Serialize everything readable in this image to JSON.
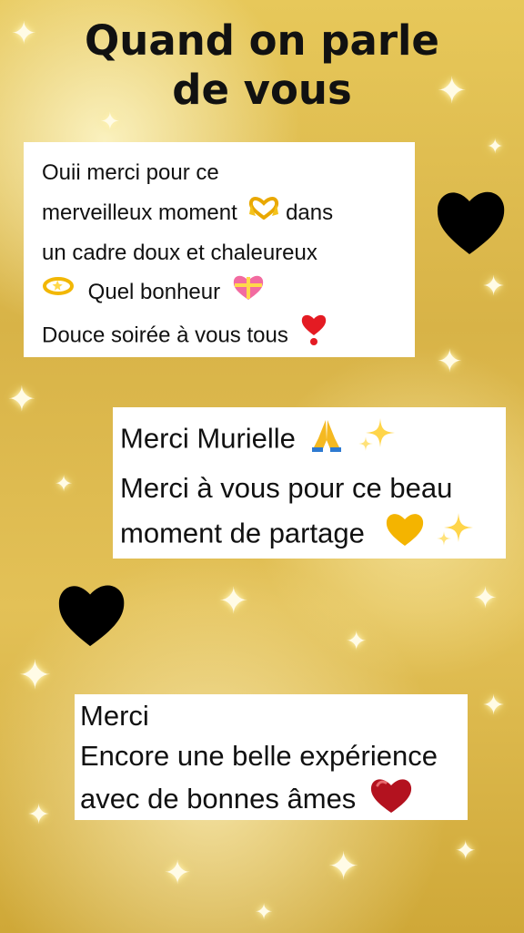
{
  "title": {
    "line1": "Quand on parle",
    "line2": "de vous"
  },
  "messages": [
    {
      "lines": [
        "Ouii merci pour ce",
        "merveilleux moment",
        "dans",
        "un cadre doux et chaleureux",
        "Quel bonheur",
        "Douce soirée à vous tous"
      ]
    },
    {
      "lines": [
        "Merci Murielle",
        "Merci à vous pour ce beau",
        "moment de partage"
      ]
    },
    {
      "lines": [
        "Merci",
        "Encore une belle expérience",
        "avec de bonnes âmes"
      ]
    }
  ],
  "icons": {
    "heart_hands": "heart-hands-icon",
    "halo": "halo-icon",
    "gift_heart": "gift-heart-icon",
    "exclamation_heart": "heavy-heart-exclamation-icon",
    "pray": "folded-hands-icon",
    "sparkles": "sparkles-icon",
    "yellow_heart": "yellow-heart-icon",
    "red_heart": "red-heart-icon",
    "black_heart": "black-heart-icon"
  },
  "colors": {
    "background_gold": "#dcb94c",
    "bubble": "#ffffff",
    "text": "#111111",
    "black_heart": "#000000",
    "red_heart": "#b3121f",
    "yellow_heart": "#f4b400"
  }
}
